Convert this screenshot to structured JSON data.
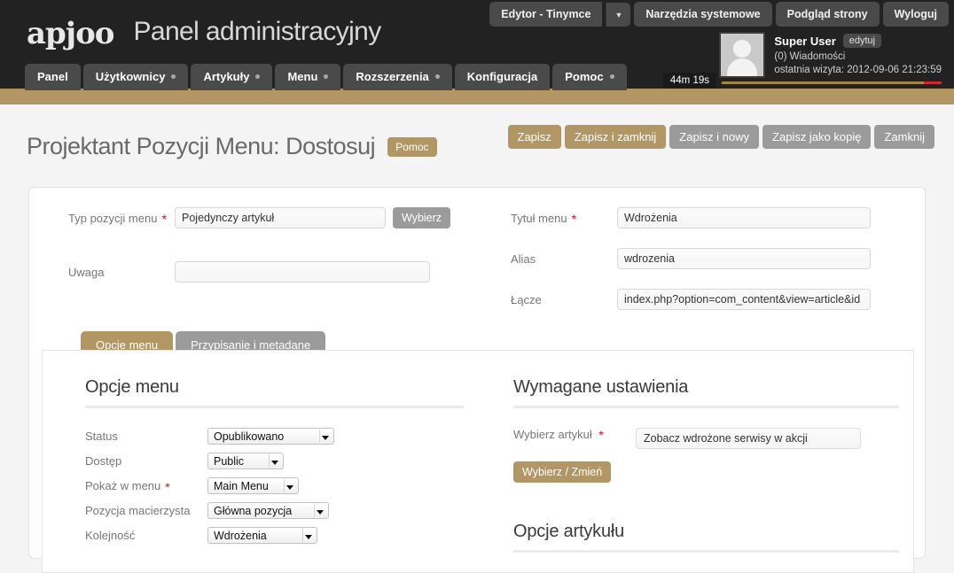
{
  "header": {
    "logo_text": "apjoo",
    "app_title": "Panel administracyjny",
    "top_buttons": [
      {
        "label": "Edytor - Tinymce",
        "has_caret": true,
        "caret": "▼"
      },
      {
        "label": "Narzędzia systemowe",
        "has_caret": false
      },
      {
        "label": "Podgląd strony",
        "has_caret": false
      },
      {
        "label": "Wyloguj",
        "has_caret": false
      }
    ],
    "nav": [
      {
        "label": "Panel",
        "dot": false
      },
      {
        "label": "Użytkownicy",
        "dot": true
      },
      {
        "label": "Artykuły",
        "dot": true
      },
      {
        "label": "Menu",
        "dot": true
      },
      {
        "label": "Rozszerzenia",
        "dot": true
      },
      {
        "label": "Konfiguracja",
        "dot": false
      },
      {
        "label": "Pomoc",
        "dot": true
      }
    ],
    "user": {
      "name": "Super User",
      "edit_label": "edytuj",
      "messages": "(0) Wiadomości",
      "last_visit": "ostatnia wizyta: 2012-09-06 21:23:59",
      "session_timer": "44m 19s"
    }
  },
  "page": {
    "title": "Projektant Pozycji Menu: Dostosuj",
    "help_badge": "Pomoc",
    "toolbar": [
      {
        "label": "Zapisz",
        "style": "gold"
      },
      {
        "label": "Zapisz i zamknij",
        "style": "gold"
      },
      {
        "label": "Zapisz i nowy",
        "style": "gray"
      },
      {
        "label": "Zapisz jako kopię",
        "style": "gray"
      },
      {
        "label": "Zamknij",
        "style": "gray"
      }
    ]
  },
  "form": {
    "menu_type": {
      "label": "Typ pozycji menu",
      "value": "Pojedynczy artykuł",
      "button": "Wybierz",
      "required": true
    },
    "uwaga": {
      "label": "Uwaga",
      "value": "",
      "required": false
    },
    "menu_title": {
      "label": "Tytuł menu",
      "value": "Wdrożenia",
      "required": true
    },
    "alias": {
      "label": "Alias",
      "value": "wdrozenia",
      "required": false
    },
    "link": {
      "label": "Łącze",
      "value": "index.php?option=com_content&view=article&id",
      "required": false
    }
  },
  "tabs": [
    {
      "label": "Opcje menu",
      "active": true
    },
    {
      "label": "Przypisanie i metadane",
      "active": false
    }
  ],
  "menu_options": {
    "heading": "Opcje menu",
    "fields": [
      {
        "label": "Status",
        "value": "Opublikowano",
        "required": false
      },
      {
        "label": "Dostęp",
        "value": "Public",
        "required": false
      },
      {
        "label": "Pokaż w menu",
        "value": "Main Menu",
        "required": true
      },
      {
        "label": "Pozycja macierzysta",
        "value": "Główna pozycja",
        "required": false
      },
      {
        "label": "Kolejność",
        "value": "Wdrożenia",
        "required": false
      }
    ]
  },
  "required_settings": {
    "heading": "Wymagane ustawienia",
    "article_label": "Wybierz artykuł",
    "article_value": "Zobacz wdrożone serwisy w akcji",
    "article_button": "Wybierz / Zmień"
  },
  "article_options": {
    "heading": "Opcje artykułu"
  },
  "colors": {
    "gold": "#b29765",
    "gray_button": "#9b9b9b",
    "header_bg": "#222222",
    "page_bg": "#f4f4f4",
    "required_star": "#d31010"
  }
}
